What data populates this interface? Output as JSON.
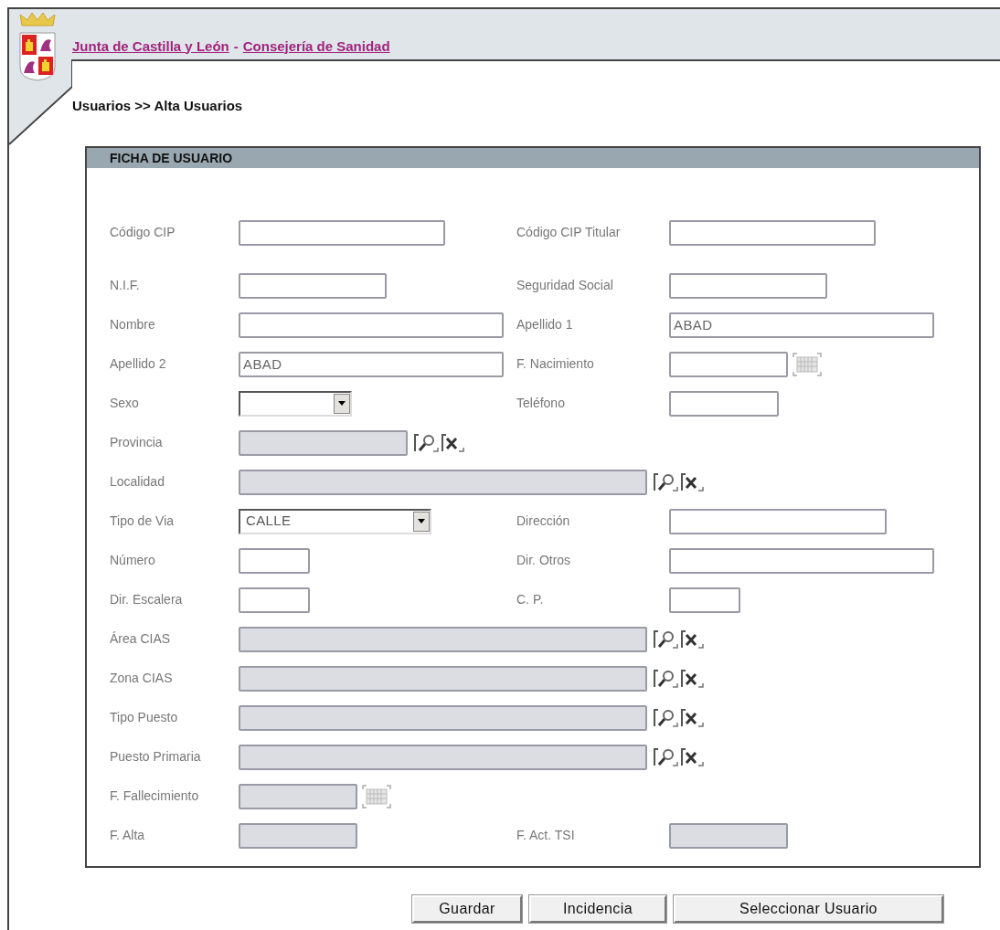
{
  "header": {
    "links": [
      "Junta de Castilla y León",
      "Consejería de Sanidad"
    ],
    "separator": "-"
  },
  "breadcrumb": "Usuarios >> Alta Usuarios",
  "panel": {
    "title": "FICHA DE USUARIO",
    "rows": [
      {
        "left": {
          "label": "Código CIP",
          "kind": "text",
          "disabled": false
        },
        "right": {
          "label": "Código CIP Titular",
          "kind": "text",
          "disabled": false
        }
      },
      {
        "left": {
          "label": "N.I.F.",
          "kind": "text",
          "disabled": false
        },
        "right": {
          "label": "Seguridad Social",
          "kind": "text",
          "disabled": false
        }
      },
      {
        "left": {
          "label": "Nombre",
          "kind": "text",
          "disabled": false
        },
        "right": {
          "label": "Apellido 1",
          "kind": "text",
          "disabled": false,
          "value": "ABAD"
        }
      },
      {
        "left": {
          "label": "Apellido 2",
          "kind": "text",
          "disabled": false,
          "value": "ABAD"
        },
        "right": {
          "label": "F. Nacimiento",
          "kind": "date",
          "disabled": false
        }
      },
      {
        "left": {
          "label": "Sexo",
          "kind": "select",
          "disabled": false
        },
        "right": {
          "label": "Teléfono",
          "kind": "text",
          "disabled": false
        }
      },
      {
        "left": {
          "label": "Provincia",
          "kind": "lookup",
          "disabled": true
        }
      },
      {
        "left": {
          "label": "Localidad",
          "kind": "lookup",
          "disabled": true
        }
      },
      {
        "left": {
          "label": "Tipo de Via",
          "kind": "select",
          "disabled": false,
          "value": "CALLE"
        },
        "right": {
          "label": "Dirección",
          "kind": "text",
          "disabled": false
        }
      },
      {
        "left": {
          "label": "Número",
          "kind": "text",
          "disabled": false
        },
        "right": {
          "label": "Dir. Otros",
          "kind": "text",
          "disabled": false
        }
      },
      {
        "left": {
          "label": "Dir. Escalera",
          "kind": "text",
          "disabled": false
        },
        "right": {
          "label": "C. P.",
          "kind": "text",
          "disabled": false
        }
      },
      {
        "left": {
          "label": "Área CIAS",
          "kind": "lookup",
          "disabled": true
        }
      },
      {
        "left": {
          "label": "Zona CIAS",
          "kind": "lookup",
          "disabled": true
        }
      },
      {
        "left": {
          "label": "Tipo Puesto",
          "kind": "lookup",
          "disabled": true
        }
      },
      {
        "left": {
          "label": "Puesto Primaria",
          "kind": "lookup",
          "disabled": true
        }
      },
      {
        "left": {
          "label": "F. Fallecimiento",
          "kind": "date",
          "disabled": true
        }
      },
      {
        "left": {
          "label": "F. Alta",
          "kind": "text",
          "disabled": true
        },
        "right": {
          "label": "F. Act. TSI",
          "kind": "text",
          "disabled": true
        }
      }
    ]
  },
  "buttons": [
    "Guardar",
    "Incidencia",
    "Seleccionar Usuario"
  ]
}
